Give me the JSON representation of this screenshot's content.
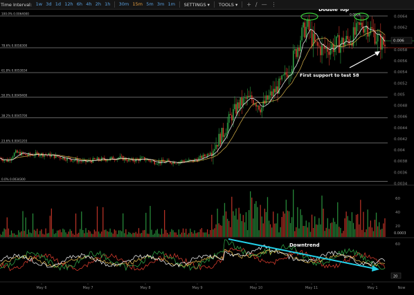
{
  "toolbar": {
    "label": "Time Interval:",
    "intervals": [
      "1w",
      "3d",
      "1d",
      "12h",
      "6h",
      "4h",
      "2h",
      "1h",
      "30m",
      "15m",
      "5m",
      "3m",
      "1m"
    ],
    "active_interval": "15m",
    "settings_label": "SETTINGS",
    "tools_label": "TOOLS"
  },
  "chart_data": {
    "type": "candlestick",
    "ylim": [
      0.0034,
      0.0065
    ],
    "y_ticks": [
      "0.0064",
      "0.0062",
      "0.006",
      "0.0058",
      "0.0056",
      "0.0054",
      "0.0052",
      "0.005",
      "0.0048",
      "0.0046",
      "0.0044",
      "0.0042",
      "0.004",
      "0.0038",
      "0.0036",
      "0.0034"
    ],
    "y_tick_values": [
      0.0064,
      0.0062,
      0.006,
      0.0058,
      0.0056,
      0.0054,
      0.0052,
      0.005,
      0.0048,
      0.0046,
      0.0044,
      0.0042,
      0.004,
      0.0038,
      0.0036,
      0.0034
    ],
    "x_ticks": [
      "May 6",
      "May 7",
      "May 8",
      "May 9",
      "May 10",
      "May 11",
      "May 1",
      "Now"
    ],
    "fib_levels": [
      {
        "label": "100.0% 0.0064000",
        "value": 0.0064
      },
      {
        "label": "78.6% 0.0058300",
        "value": 0.00583
      },
      {
        "label": "61.8% 0.0053834",
        "value": 0.0053834
      },
      {
        "label": "50.0% 0.0049400",
        "value": 0.00494
      },
      {
        "label": "38.2% 0.0045700",
        "value": 0.00457
      },
      {
        "label": "23.6% 0.0041203",
        "value": 0.0041203
      },
      {
        "label": "0.0% 0.0034300",
        "value": 0.00343
      }
    ],
    "current_price_label": "0.006",
    "last_value_label": "0.0064",
    "price_path": [
      [
        0,
        0.00385
      ],
      [
        0.02,
        0.0038
      ],
      [
        0.04,
        0.00395
      ],
      [
        0.07,
        0.0039
      ],
      [
        0.1,
        0.00392
      ],
      [
        0.13,
        0.0039
      ],
      [
        0.16,
        0.00386
      ],
      [
        0.19,
        0.00382
      ],
      [
        0.22,
        0.00378
      ],
      [
        0.25,
        0.00382
      ],
      [
        0.28,
        0.00383
      ],
      [
        0.31,
        0.00386
      ],
      [
        0.34,
        0.0038
      ],
      [
        0.37,
        0.00384
      ],
      [
        0.4,
        0.00378
      ],
      [
        0.43,
        0.00378
      ],
      [
        0.46,
        0.00378
      ],
      [
        0.48,
        0.0038
      ],
      [
        0.5,
        0.0038
      ],
      [
        0.52,
        0.00385
      ],
      [
        0.54,
        0.00392
      ],
      [
        0.56,
        0.0041
      ],
      [
        0.58,
        0.0043
      ],
      [
        0.6,
        0.0046
      ],
      [
        0.62,
        0.0048
      ],
      [
        0.64,
        0.0049
      ],
      [
        0.66,
        0.0049
      ],
      [
        0.68,
        0.00475
      ],
      [
        0.7,
        0.00495
      ],
      [
        0.72,
        0.0051
      ],
      [
        0.74,
        0.0053
      ],
      [
        0.76,
        0.0056
      ],
      [
        0.78,
        0.006
      ],
      [
        0.79,
        0.00615
      ],
      [
        0.8,
        0.0062
      ],
      [
        0.81,
        0.006
      ],
      [
        0.82,
        0.00585
      ],
      [
        0.84,
        0.0058
      ],
      [
        0.86,
        0.00585
      ],
      [
        0.88,
        0.0059
      ],
      [
        0.9,
        0.00595
      ],
      [
        0.92,
        0.00605
      ],
      [
        0.94,
        0.00625
      ],
      [
        0.955,
        0.0062
      ],
      [
        0.97,
        0.0061
      ],
      [
        0.985,
        0.00595
      ],
      [
        1.0,
        0.00588
      ]
    ],
    "volume_ticks": [
      "60",
      "40",
      "20"
    ],
    "volume_current_label": "0.0003",
    "indicator_ticks": [
      "60",
      "20"
    ],
    "indicator_current_label": "20",
    "annotations": {
      "double_top": "Double Top",
      "first_support": "First support to test 58",
      "downtrend": "Downtrend"
    },
    "colors": {
      "up": "#2ea043",
      "down": "#d33a2c",
      "fib_line": "#bdbdbd",
      "ma_white": "#e6e6e6",
      "ma_gold": "#d8b24a",
      "ellipse": "#3ad13a",
      "downtrend_line": "#22d0e8",
      "price_level": "#c0392b"
    }
  }
}
